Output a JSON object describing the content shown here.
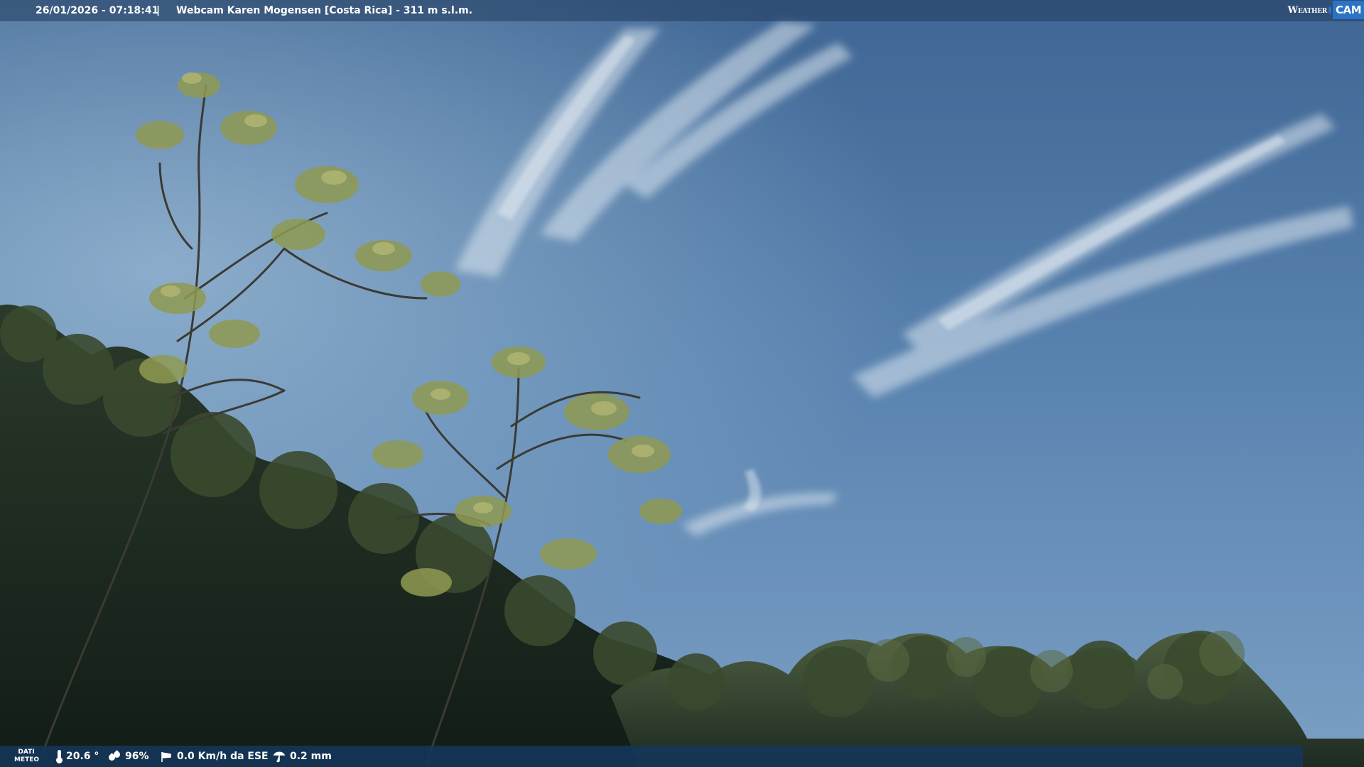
{
  "overlay": {
    "datetime": "26/01/2026 - 07:18:41",
    "separator": "|",
    "caption": "Webcam Karen Mogensen [Costa Rica] - 311 m s.l.m.",
    "brand": {
      "weather": "Weather",
      "cam": "CAM"
    }
  },
  "meteo": {
    "label_line1": "DATI",
    "label_line2": "METEO",
    "temperature": "20.6 °",
    "humidity": "96%",
    "wind": "0.0 Km/h da ESE",
    "rain": "0.2 mm"
  },
  "icons": {
    "temperature": "thermometer-icon",
    "humidity": "humidity-drops-icon",
    "wind": "wind-sock-icon",
    "rain": "rain-gauge-icon"
  },
  "colors": {
    "brand_blue": "#2a73c7",
    "bar_blue": "#14375a",
    "sky_top": "#3d6490",
    "sky_mid": "#5d87b2",
    "foliage_dark": "#1a2a1e"
  }
}
